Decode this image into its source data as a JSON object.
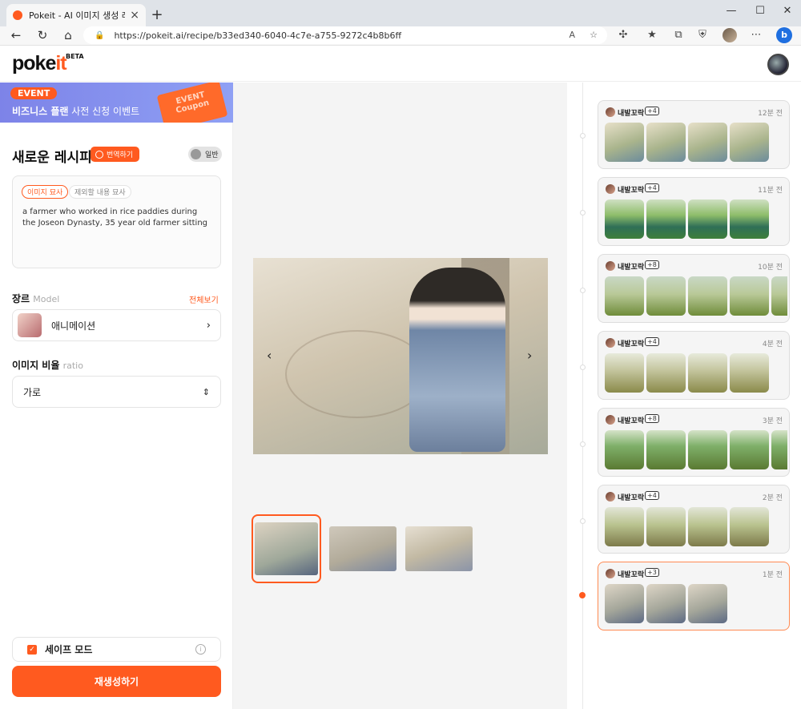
{
  "browser": {
    "tab_title": "Pokeit - AI 이미지 생성 레시피 중",
    "url": "https://pokeit.ai/recipe/b33ed340-6040-4c7e-a755-9272c4b8b6ff"
  },
  "header": {
    "logo_main": "poke",
    "logo_accent": "it",
    "beta": "BETA"
  },
  "banner": {
    "badge": "EVENT",
    "text_bold": "비즈니스 플랜",
    "text_rest": " 사전 신청 이벤트",
    "coupon": "EVENT Coupon"
  },
  "recipe": {
    "title": "새로운 레시피",
    "translate_label": "번역하기",
    "toggle_label": "일반",
    "prompt_tab_active": "이미지 묘사",
    "prompt_tab_other": "제외할 내용 묘사",
    "prompt_text": "a farmer who worked in rice paddies during the Joseon Dynasty, 35 year old farmer sitting"
  },
  "genre": {
    "label": "장르",
    "label_sub": "Model",
    "see_all": "전체보기",
    "model_name": "애니메이션"
  },
  "ratio": {
    "label": "이미지 비율",
    "label_sub": "ratio",
    "value": "가로"
  },
  "safe_mode": {
    "label": "세이프 모드",
    "checked": true
  },
  "regenerate_label": "재생성하기",
  "history": [
    {
      "user": "내발꼬락",
      "count": "+4",
      "time": "12분 전"
    },
    {
      "user": "내발꼬락",
      "count": "+4",
      "time": "11분 전"
    },
    {
      "user": "내발꼬락",
      "count": "+8",
      "time": "10분 전"
    },
    {
      "user": "내발꼬락",
      "count": "+4",
      "time": "4분 전"
    },
    {
      "user": "내발꼬락",
      "count": "+8",
      "time": "3분 전"
    },
    {
      "user": "내발꼬락",
      "count": "+4",
      "time": "2분 전"
    },
    {
      "user": "내발꼬락",
      "count": "+3",
      "time": "1분 전"
    }
  ],
  "colors": {
    "accent": "#ff5a1f",
    "banner": "#8fa0f4"
  }
}
